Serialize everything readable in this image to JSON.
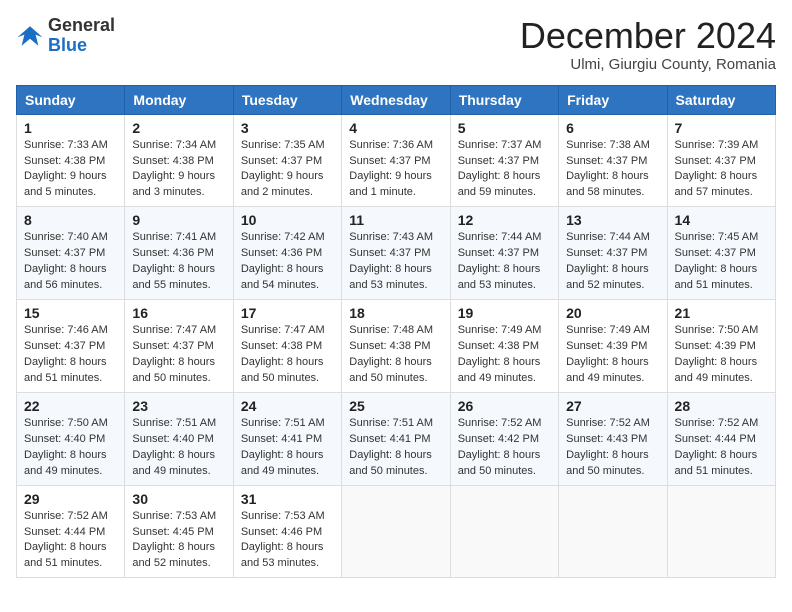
{
  "logo": {
    "general": "General",
    "blue": "Blue"
  },
  "title": "December 2024",
  "location": "Ulmi, Giurgiu County, Romania",
  "days_of_week": [
    "Sunday",
    "Monday",
    "Tuesday",
    "Wednesday",
    "Thursday",
    "Friday",
    "Saturday"
  ],
  "weeks": [
    [
      {
        "day": "1",
        "sunrise": "7:33 AM",
        "sunset": "4:38 PM",
        "daylight": "9 hours and 5 minutes."
      },
      {
        "day": "2",
        "sunrise": "7:34 AM",
        "sunset": "4:38 PM",
        "daylight": "9 hours and 3 minutes."
      },
      {
        "day": "3",
        "sunrise": "7:35 AM",
        "sunset": "4:37 PM",
        "daylight": "9 hours and 2 minutes."
      },
      {
        "day": "4",
        "sunrise": "7:36 AM",
        "sunset": "4:37 PM",
        "daylight": "9 hours and 1 minute."
      },
      {
        "day": "5",
        "sunrise": "7:37 AM",
        "sunset": "4:37 PM",
        "daylight": "8 hours and 59 minutes."
      },
      {
        "day": "6",
        "sunrise": "7:38 AM",
        "sunset": "4:37 PM",
        "daylight": "8 hours and 58 minutes."
      },
      {
        "day": "7",
        "sunrise": "7:39 AM",
        "sunset": "4:37 PM",
        "daylight": "8 hours and 57 minutes."
      }
    ],
    [
      {
        "day": "8",
        "sunrise": "7:40 AM",
        "sunset": "4:37 PM",
        "daylight": "8 hours and 56 minutes."
      },
      {
        "day": "9",
        "sunrise": "7:41 AM",
        "sunset": "4:36 PM",
        "daylight": "8 hours and 55 minutes."
      },
      {
        "day": "10",
        "sunrise": "7:42 AM",
        "sunset": "4:36 PM",
        "daylight": "8 hours and 54 minutes."
      },
      {
        "day": "11",
        "sunrise": "7:43 AM",
        "sunset": "4:37 PM",
        "daylight": "8 hours and 53 minutes."
      },
      {
        "day": "12",
        "sunrise": "7:44 AM",
        "sunset": "4:37 PM",
        "daylight": "8 hours and 53 minutes."
      },
      {
        "day": "13",
        "sunrise": "7:44 AM",
        "sunset": "4:37 PM",
        "daylight": "8 hours and 52 minutes."
      },
      {
        "day": "14",
        "sunrise": "7:45 AM",
        "sunset": "4:37 PM",
        "daylight": "8 hours and 51 minutes."
      }
    ],
    [
      {
        "day": "15",
        "sunrise": "7:46 AM",
        "sunset": "4:37 PM",
        "daylight": "8 hours and 51 minutes."
      },
      {
        "day": "16",
        "sunrise": "7:47 AM",
        "sunset": "4:37 PM",
        "daylight": "8 hours and 50 minutes."
      },
      {
        "day": "17",
        "sunrise": "7:47 AM",
        "sunset": "4:38 PM",
        "daylight": "8 hours and 50 minutes."
      },
      {
        "day": "18",
        "sunrise": "7:48 AM",
        "sunset": "4:38 PM",
        "daylight": "8 hours and 50 minutes."
      },
      {
        "day": "19",
        "sunrise": "7:49 AM",
        "sunset": "4:38 PM",
        "daylight": "8 hours and 49 minutes."
      },
      {
        "day": "20",
        "sunrise": "7:49 AM",
        "sunset": "4:39 PM",
        "daylight": "8 hours and 49 minutes."
      },
      {
        "day": "21",
        "sunrise": "7:50 AM",
        "sunset": "4:39 PM",
        "daylight": "8 hours and 49 minutes."
      }
    ],
    [
      {
        "day": "22",
        "sunrise": "7:50 AM",
        "sunset": "4:40 PM",
        "daylight": "8 hours and 49 minutes."
      },
      {
        "day": "23",
        "sunrise": "7:51 AM",
        "sunset": "4:40 PM",
        "daylight": "8 hours and 49 minutes."
      },
      {
        "day": "24",
        "sunrise": "7:51 AM",
        "sunset": "4:41 PM",
        "daylight": "8 hours and 49 minutes."
      },
      {
        "day": "25",
        "sunrise": "7:51 AM",
        "sunset": "4:41 PM",
        "daylight": "8 hours and 50 minutes."
      },
      {
        "day": "26",
        "sunrise": "7:52 AM",
        "sunset": "4:42 PM",
        "daylight": "8 hours and 50 minutes."
      },
      {
        "day": "27",
        "sunrise": "7:52 AM",
        "sunset": "4:43 PM",
        "daylight": "8 hours and 50 minutes."
      },
      {
        "day": "28",
        "sunrise": "7:52 AM",
        "sunset": "4:44 PM",
        "daylight": "8 hours and 51 minutes."
      }
    ],
    [
      {
        "day": "29",
        "sunrise": "7:52 AM",
        "sunset": "4:44 PM",
        "daylight": "8 hours and 51 minutes."
      },
      {
        "day": "30",
        "sunrise": "7:53 AM",
        "sunset": "4:45 PM",
        "daylight": "8 hours and 52 minutes."
      },
      {
        "day": "31",
        "sunrise": "7:53 AM",
        "sunset": "4:46 PM",
        "daylight": "8 hours and 53 minutes."
      },
      null,
      null,
      null,
      null
    ]
  ],
  "labels": {
    "sunrise": "Sunrise:",
    "sunset": "Sunset:",
    "daylight": "Daylight:"
  }
}
